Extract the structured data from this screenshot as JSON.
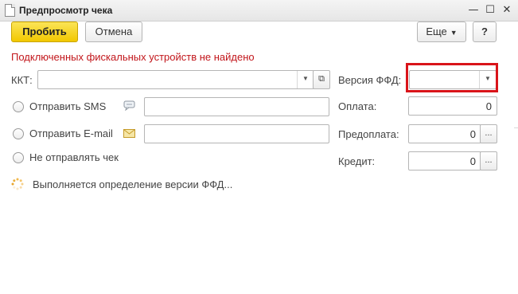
{
  "window": {
    "title": "Предпросмотр чека"
  },
  "toolbar": {
    "print_label": "Пробить",
    "cancel_label": "Отмена",
    "more_label": "Еще",
    "help_label": "?"
  },
  "error_message": "Подключенных фискальных устройств не найдено",
  "kkt": {
    "label": "ККТ:",
    "value": ""
  },
  "send_sms": {
    "label": "Отправить SMS",
    "value": ""
  },
  "send_email": {
    "label": "Отправить E-mail",
    "value": ""
  },
  "no_send": {
    "label": "Не отправлять чек"
  },
  "ffd": {
    "label": "Версия ФФД:",
    "value": ""
  },
  "payment": {
    "label": "Оплата:",
    "value": "0"
  },
  "prepayment": {
    "label": "Предоплата:",
    "value": "0"
  },
  "credit": {
    "label": "Кредит:",
    "value": "0"
  },
  "status": "Выполняется определение версии ФФД...",
  "icons": {
    "close": "close-icon",
    "maximize": "maximize-icon",
    "minimize": "minimize-icon",
    "more_actions": "ellipsis-icon"
  },
  "colors": {
    "primary_button": "#f2c800",
    "error_text": "#c2161b",
    "highlight_border": "#d9141a"
  }
}
